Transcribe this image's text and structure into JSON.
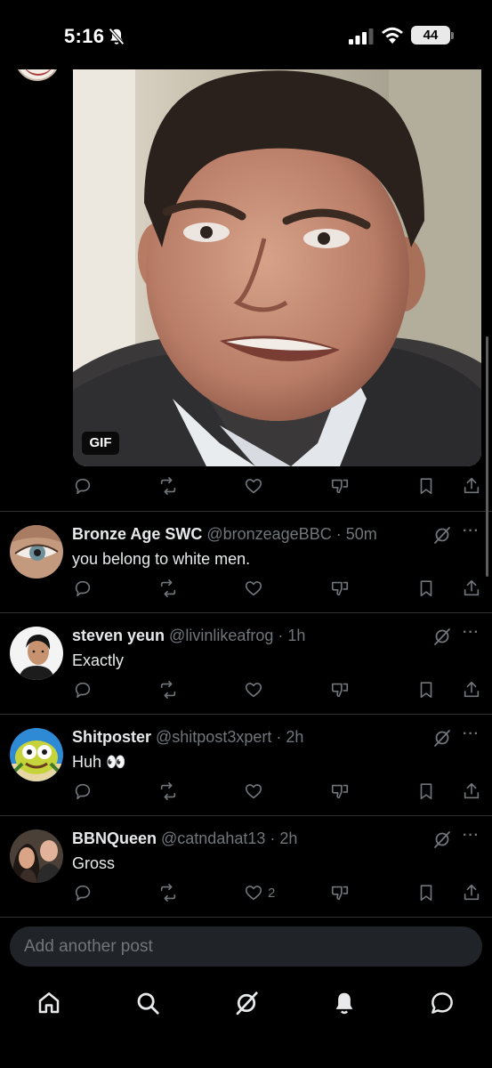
{
  "status_bar": {
    "time": "5:16",
    "battery": "44"
  },
  "gif": {
    "badge": "GIF"
  },
  "replies": [
    {
      "name": "Bronze Age SWC",
      "handle": "@bronzeageBBC · 50m",
      "text": "you belong to white men.",
      "likes": ""
    },
    {
      "name": "steven yeun",
      "handle": "@livinlikeafrog · 1h",
      "text": "Exactly",
      "likes": ""
    },
    {
      "name": "Shitposter",
      "handle": "@shitpost3xpert · 2h",
      "text": "Huh",
      "emoji": "👀",
      "likes": ""
    },
    {
      "name": "BBNQueen",
      "handle": "@catndahat13 · 2h",
      "text": "Gross",
      "likes": "2"
    }
  ],
  "compose": {
    "placeholder": "Add another post"
  },
  "more_glyph": "···",
  "colors": {
    "background": "#000000",
    "text": "#e7e9ea",
    "muted": "#71767b",
    "divider": "#2f3336",
    "compose_bg": "#202327"
  },
  "icons": [
    "bell-off-icon",
    "signal-icon",
    "wifi-icon",
    "reply-icon",
    "repost-icon",
    "like-icon",
    "downvote-icon",
    "bookmark-icon",
    "share-icon",
    "grok-icon",
    "home-icon",
    "search-icon",
    "notifications-icon",
    "messages-icon"
  ]
}
